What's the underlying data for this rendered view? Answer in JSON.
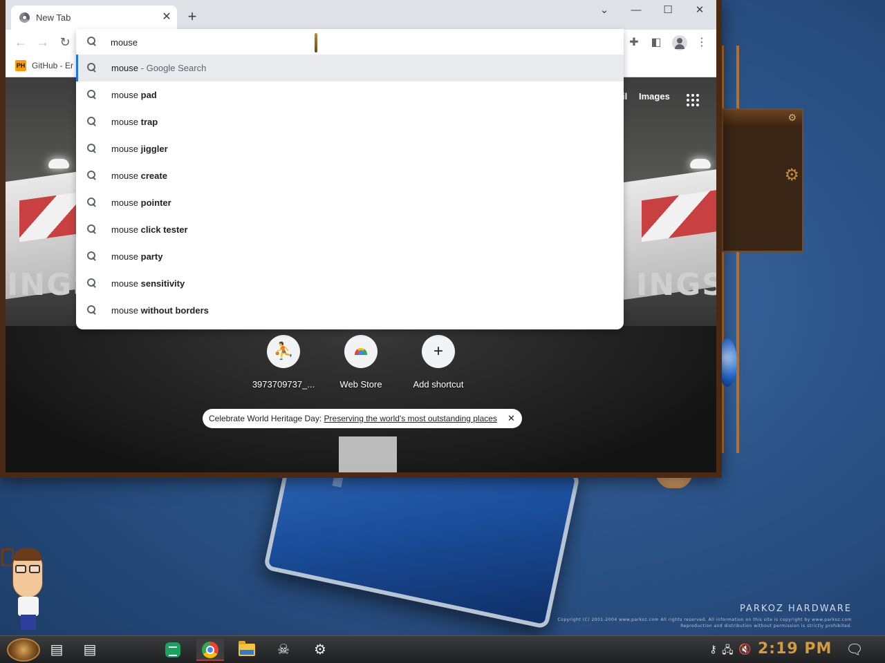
{
  "browser": {
    "tab_title": "New Tab",
    "tab_close": "✕",
    "new_tab": "+",
    "window_controls": {
      "dropdown": "⌄",
      "minimize": "—",
      "maximize": "☐",
      "close": "✕"
    },
    "bookmark": {
      "favicon_text": "PH",
      "label": "GitHub - Er"
    }
  },
  "omnibox": {
    "value": "mouse",
    "suggestions": [
      {
        "query": "mouse",
        "rest": "",
        "suffix": " - Google Search"
      },
      {
        "query": "mouse ",
        "rest": "pad",
        "suffix": ""
      },
      {
        "query": "mouse ",
        "rest": "trap",
        "suffix": ""
      },
      {
        "query": "mouse ",
        "rest": "jiggler",
        "suffix": ""
      },
      {
        "query": "mouse ",
        "rest": "create",
        "suffix": ""
      },
      {
        "query": "mouse ",
        "rest": "pointer",
        "suffix": ""
      },
      {
        "query": "mouse ",
        "rest": "click tester",
        "suffix": ""
      },
      {
        "query": "mouse ",
        "rest": "party",
        "suffix": ""
      },
      {
        "query": "mouse ",
        "rest": "sensitivity",
        "suffix": ""
      },
      {
        "query": "mouse ",
        "rest": "without borders",
        "suffix": ""
      }
    ]
  },
  "ntp": {
    "links": {
      "gmail_partial": "il",
      "images": "Images"
    },
    "background_word": "INGS",
    "shortcuts": [
      {
        "label": "3973709737_..."
      },
      {
        "label": "Web Store"
      },
      {
        "label": "Add shortcut",
        "glyph": "+"
      }
    ],
    "promo": {
      "text": "Celebrate World Heritage Day: ",
      "link": "Preserving the world's most outstanding places",
      "close": "✕"
    }
  },
  "desktop": {
    "brand": "PARKOZ HARDWARE",
    "copyright_line1": "Copyright (C) 2001-2004 www.parkoz.com All rights reserved. All information on this site is copyright by www.parkoz.com",
    "copyright_line2": "Reproduction and distribution without permission is strictly prohibited."
  },
  "taskbar": {
    "clock": "2:19 PM"
  }
}
